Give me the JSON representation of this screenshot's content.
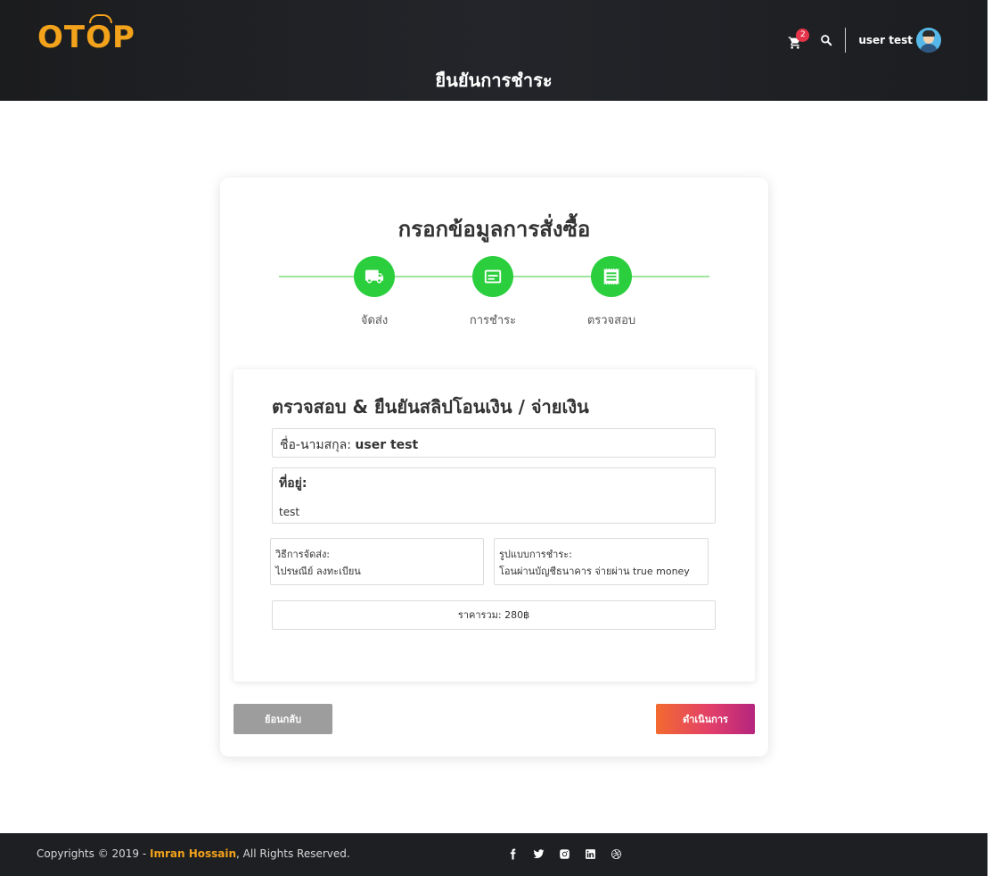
{
  "header": {
    "logo": "OTOP",
    "page_title": "ยืนยันการชำระ",
    "cart_count": "2",
    "username": "user test"
  },
  "card": {
    "title": "กรอกข้อมูลการสั่งซื้อ",
    "steps": [
      {
        "label": "จัดส่ง",
        "icon": "truck-icon"
      },
      {
        "label": "การชำระ",
        "icon": "card-icon"
      },
      {
        "label": "ตรวจสอบ",
        "icon": "receipt-icon"
      }
    ],
    "review": {
      "title": "ตรวจสอบ & ยืนยันสลิปโอนเงิน / จ่ายเงิน",
      "name_label": "ชื่อ-นามสกุล:",
      "name_value": "user test",
      "address_label": "ที่อยู่:",
      "address_value": "test",
      "shipping_label": "วิธีการจัดส่ง:",
      "shipping_value": "ไปรษณีย์ ลงทะเบียน",
      "payment_label": "รูปแบบการชำระ:",
      "payment_value": "โอนผ่านบัญชีธนาคาร จ่ายผ่าน true money",
      "total_text": "ราคารวม: 280฿"
    },
    "back_label": "ย้อนกลับ",
    "next_label": "ดำเนินการ"
  },
  "footer": {
    "copyright_prefix": "Copyrights © 2019 - ",
    "author": "Imran Hossain",
    "copyright_suffix": ", All Rights Reserved.",
    "social_icons": [
      "facebook-icon",
      "twitter-icon",
      "instagram-icon",
      "linkedin-icon",
      "dribbble-icon"
    ]
  },
  "colors": {
    "accent": "#f3a21b",
    "step_green": "#2bcf3e",
    "badge_red": "#e5344a",
    "header_bg": "#1b1c1e"
  }
}
